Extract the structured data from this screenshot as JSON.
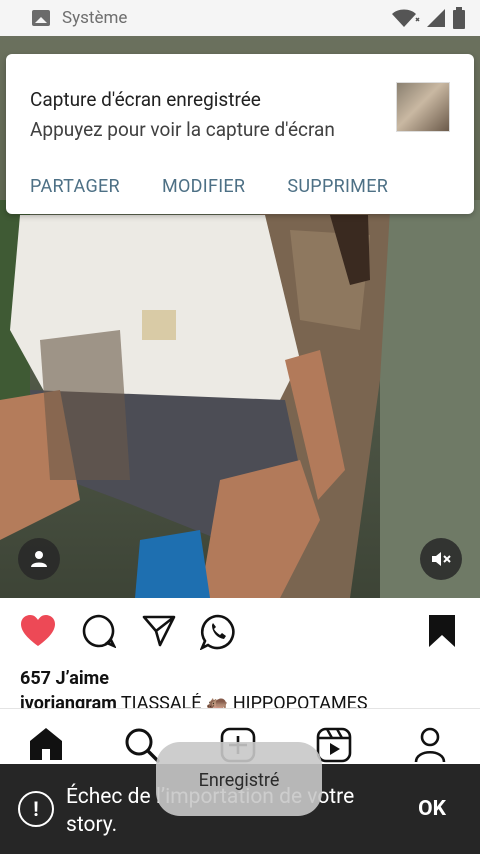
{
  "status_bar": {
    "app_label": "Système",
    "icons": [
      "image-icon",
      "wifi-icon",
      "signal-icon",
      "battery-icon"
    ]
  },
  "notification": {
    "title": "Capture d'écran enregistrée",
    "body": "Appuyez pour voir la capture d'écran",
    "actions": [
      "PARTAGER",
      "MODIFIER",
      "SUPPRIMER"
    ]
  },
  "post": {
    "likes": "657 J’aime",
    "caption_user": "ivoriangram",
    "caption_text": " TIASSALÉ 🦛 HIPPOPOTAMES"
  },
  "toast": {
    "text": "Enregistré"
  },
  "snackbar": {
    "message": "Échec de l’importation de votre story.",
    "action": "OK"
  },
  "colors": {
    "like_red": "#ed4956",
    "notification_action": "#4d7085",
    "snackbar_bg": "#262626"
  }
}
